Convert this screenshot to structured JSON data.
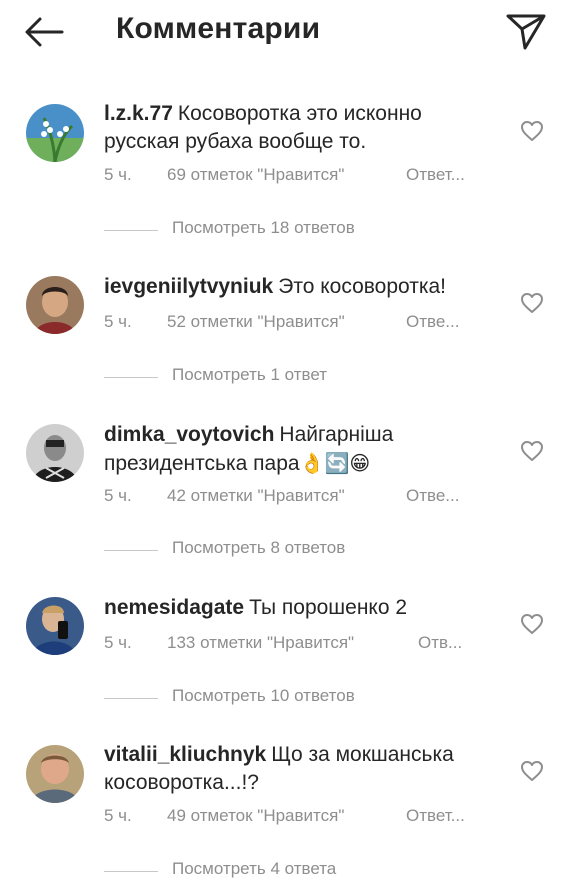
{
  "header": {
    "title": "Комментарии"
  },
  "comments": [
    {
      "username": "l.z.k.77",
      "text": "Косоворотка это исконно русская рубаха вообще то.",
      "time": "5 ч.",
      "likes": "69 отметок \"Нравится\"",
      "reply": "Ответ...",
      "view_replies": "Посмотреть 18 ответов"
    },
    {
      "username": "ievgeniilytvyniuk",
      "text": "Это косоворотка!",
      "time": "5 ч.",
      "likes": "52 отметки \"Нравится\"",
      "reply": "Отве...",
      "view_replies": "Посмотреть 1 ответ"
    },
    {
      "username": "dimka_voytovich",
      "text": "Найгарніша президентська пара",
      "emoji": "👌🔄😁",
      "time": "5 ч.",
      "likes": "42 отметки \"Нравится\"",
      "reply": "Отве...",
      "view_replies": "Посмотреть 8 ответов"
    },
    {
      "username": "nemesidagate",
      "text": "Ты порошенко 2",
      "time": "5 ч.",
      "likes": "133 отметки \"Нравится\"",
      "reply": "Отв...",
      "view_replies": "Посмотреть 10 ответов"
    },
    {
      "username": "vitalii_kliuchnyk",
      "text": "Що за мокшанська косоворотка...!?",
      "time": "5 ч.",
      "likes": "49 отметок \"Нравится\"",
      "reply": "Ответ...",
      "view_replies": "Посмотреть 4 ответа"
    }
  ]
}
